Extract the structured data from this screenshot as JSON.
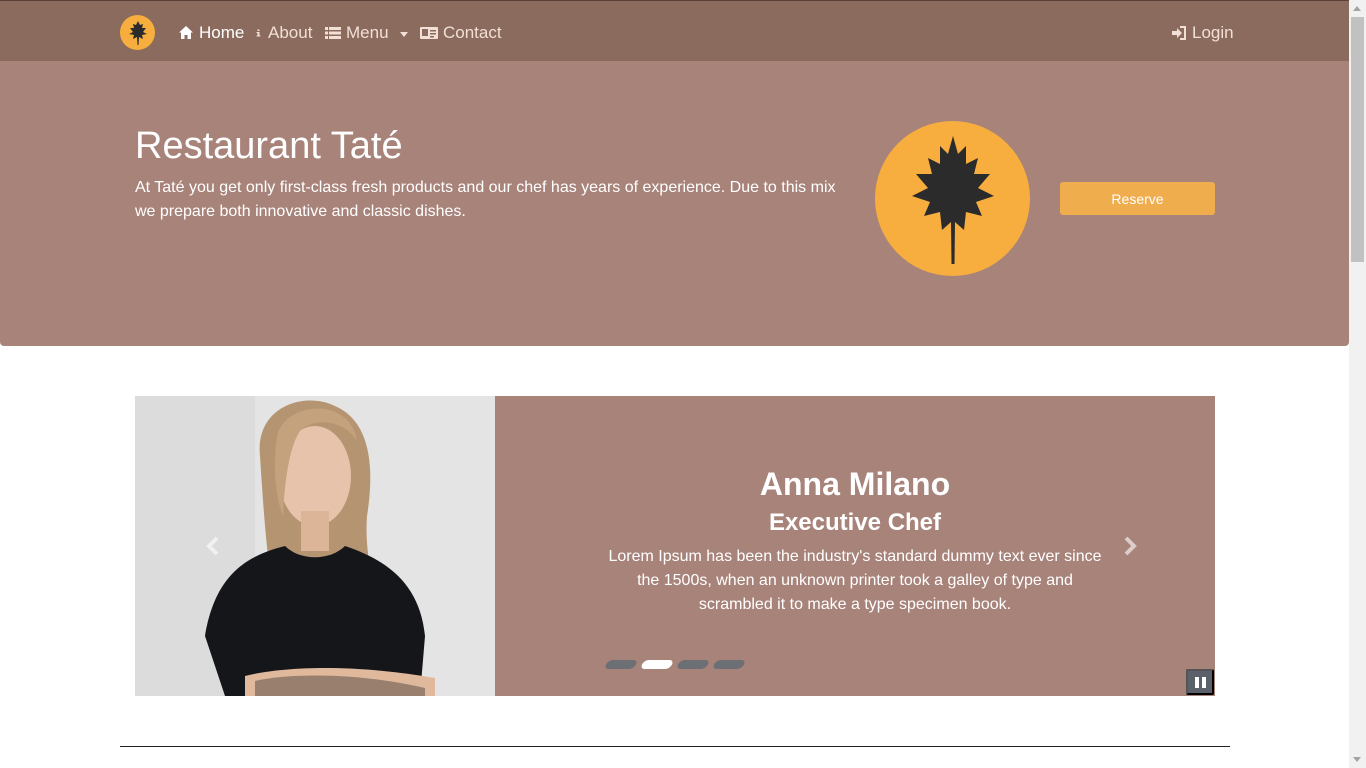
{
  "navbar": {
    "brand_icon": "leaf-icon",
    "items": [
      {
        "label": "Home",
        "icon": "home-icon",
        "active": true
      },
      {
        "label": "About",
        "icon": "info-icon",
        "active": false
      },
      {
        "label": "Menu",
        "icon": "list-icon",
        "active": false,
        "dropdown": true
      },
      {
        "label": "Contact",
        "icon": "contact-card-icon",
        "active": false
      }
    ],
    "login_label": "Login",
    "login_icon": "sign-in-icon"
  },
  "hero": {
    "title": "Restaurant Taté",
    "description": "At Taté you get only first-class fresh products and our chef has years of experience. Due to this mix we prepare both innovative and classic dishes.",
    "reserve_label": "Reserve"
  },
  "carousel": {
    "active_index": 1,
    "slide": {
      "name": "Anna Milano",
      "role": "Executive Chef",
      "description": "Lorem Ipsum has been the industry's standard dummy text ever since the 1500s, when an unknown printer took a galley of type and scrambled it to make a type specimen book."
    },
    "indicator_count": 4
  },
  "colors": {
    "navbar": "#8b6b5e",
    "hero": "#a8837a",
    "accent": "#f7ae3e",
    "button": "#f0ad4e"
  }
}
